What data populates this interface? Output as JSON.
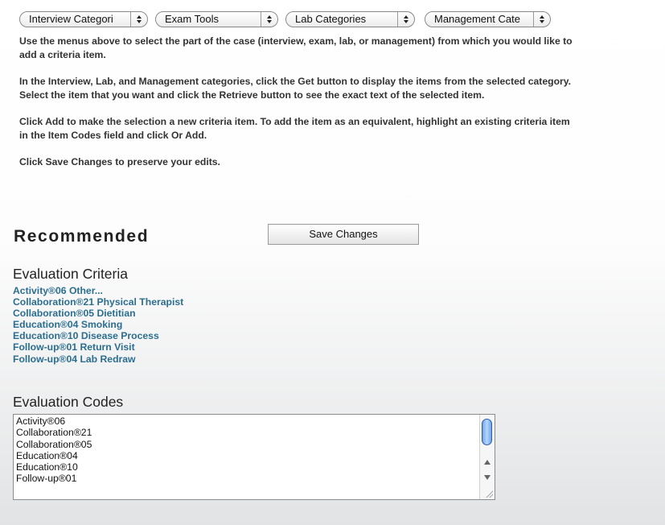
{
  "menus": [
    {
      "label": "Interview Categori"
    },
    {
      "label": "Exam Tools"
    },
    {
      "label": "Lab Categories"
    },
    {
      "label": "Management Cate"
    }
  ],
  "instructions": [
    "Use the menus above to select the part of the case (interview, exam, lab, or management) from which you would like to",
    "add a criteria item.",
    "In the Interview, Lab, and Management categories, click the Get button to display the items from the selected category.",
    "Select the item that you want and click the Retrieve button to see the exact text of the selected item.",
    "Click Add to make the selection a new criteria item. To add the item as an equivalent, highlight an existing criteria item",
    "in the Item Codes field and click Or Add.",
    "Click Save Changes to preserve your edits."
  ],
  "recommended": {
    "title": "Recommended",
    "save_label": "Save Changes"
  },
  "criteria": {
    "title": "Evaluation Criteria",
    "items": [
      "Activity®06 Other...",
      "Collaboration®21 Physical Therapist",
      "Collaboration®05 Dietitian",
      "Education®04 Smoking",
      "Education®10 Disease Process",
      "Follow-up®01 Return Visit",
      "Follow-up®04 Lab Redraw"
    ]
  },
  "codes": {
    "title": "Evaluation Codes",
    "items": [
      "Activity®06",
      "Collaboration®21",
      "Collaboration®05",
      "Education®04",
      "Education®10",
      "Follow-up®01"
    ]
  }
}
